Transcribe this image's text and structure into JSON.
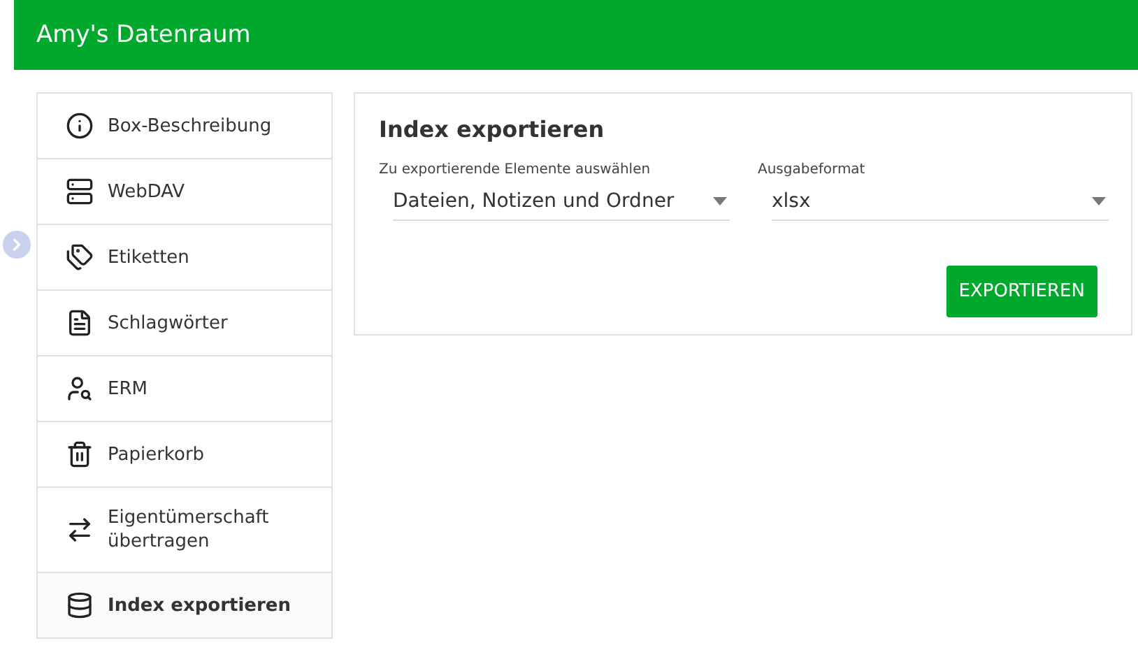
{
  "header": {
    "title": "Amy's Datenraum"
  },
  "sidebar": {
    "items": [
      {
        "kind": "info",
        "label": "Box-Beschreibung",
        "selected": false
      },
      {
        "kind": "server",
        "label": "WebDAV",
        "selected": false
      },
      {
        "kind": "tags",
        "label": "Etiketten",
        "selected": false
      },
      {
        "kind": "file-tag",
        "label": "Schlagwörter",
        "selected": false
      },
      {
        "kind": "person",
        "label": "ERM",
        "selected": false
      },
      {
        "kind": "trash",
        "label": "Papierkorb",
        "selected": false
      },
      {
        "kind": "transfer",
        "label": "Eigentümerschaft übertragen",
        "selected": false
      },
      {
        "kind": "export",
        "label": "Index exportieren",
        "selected": true
      }
    ]
  },
  "panel": {
    "title": "Index exportieren",
    "fields": [
      {
        "label": "Zu exportierende Elemente auswählen",
        "value": "Dateien, Notizen und Ordner"
      },
      {
        "label": "Ausgabeformat",
        "value": "xlsx"
      }
    ],
    "button": "EXPORTIEREN"
  }
}
